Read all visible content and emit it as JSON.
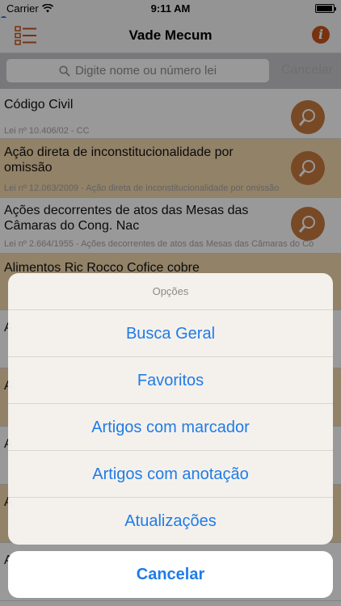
{
  "status_bar": {
    "carrier": "Carrier",
    "time": "9:11 AM"
  },
  "nav": {
    "title": "Vade Mecum",
    "left_icon": "list-menu-icon",
    "right_icon": "info-icon"
  },
  "search": {
    "placeholder": "Digite nome ou número lei",
    "cancel_label": "Cancelar"
  },
  "list": {
    "rows": [
      {
        "title": "Código Civil",
        "subtitle": "Lei nº 10.406/02 - CC",
        "highlighted": false
      },
      {
        "title": "Ação direta de inconstitucionalidade por omissão",
        "subtitle": "Lei nº 12.063/2009 - Ação direta de inconstitucionalidade por omissão",
        "highlighted": true
      },
      {
        "title": "Ações decorrentes de atos das Mesas das Câmaras do Cong. Nac",
        "subtitle": "Lei nº 2.664/1955 - Ações decorrentes de atos das Mesas das Câmaras do Co",
        "highlighted": false
      },
      {
        "title": "Alimentos Ric Rocco Cofice cobre",
        "subtitle": "",
        "highlighted": true
      },
      {
        "title": "A",
        "subtitle": "",
        "highlighted": false
      },
      {
        "title": "A",
        "subtitle": "",
        "highlighted": true
      },
      {
        "title": "A",
        "subtitle": "",
        "highlighted": false
      },
      {
        "title": "A",
        "subtitle": "",
        "highlighted": true
      },
      {
        "title": "A",
        "subtitle": "",
        "highlighted": false
      }
    ]
  },
  "action_sheet": {
    "title": "Opções",
    "options": [
      "Busca Geral",
      "Favoritos",
      "Artigos com marcador",
      "Artigos com anotação",
      "Atualizações"
    ],
    "cancel_label": "Cancelar"
  },
  "colors": {
    "accent": "#1f7ce8",
    "brand": "#c9541a",
    "row_highlight": "#f3d9ad",
    "search_button": "#c97a3e"
  }
}
